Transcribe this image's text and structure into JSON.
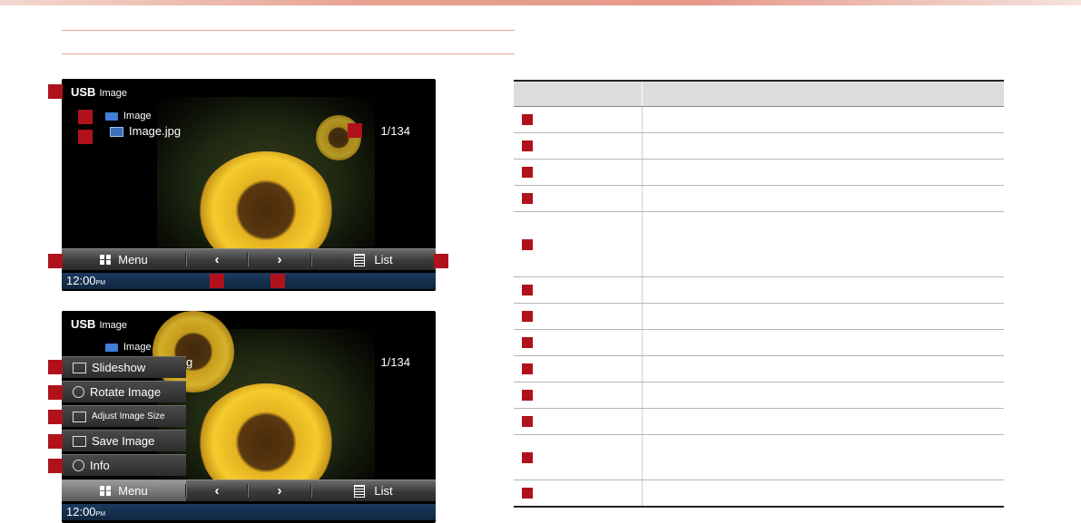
{
  "screen1": {
    "source": "USB",
    "mode": "Image",
    "folder": "Image",
    "filename": "Image.jpg",
    "counter": "1/134",
    "menu_label": "Menu",
    "prev_icon": "chevron-left-icon",
    "next_icon": "chevron-right-icon",
    "list_label": "List",
    "time": "12:00",
    "time_suffix": "PM"
  },
  "screen2": {
    "source": "USB",
    "mode": "Image",
    "folder": "Image",
    "filename_partial": "g",
    "counter": "1/134",
    "menu_items": [
      "Slideshow",
      "Rotate Image",
      "Adjust Image Size",
      "Save Image",
      "Info"
    ],
    "menu_label": "Menu",
    "list_label": "List",
    "time": "12:00",
    "time_suffix": "PM"
  },
  "legend": {
    "header": [
      "",
      ""
    ],
    "row_count": 15,
    "marker_color": "#b0121b"
  },
  "colors": {
    "accent_red": "#b0121b",
    "screen_bg": "#000000",
    "status_bar": "#1c3a5e"
  }
}
